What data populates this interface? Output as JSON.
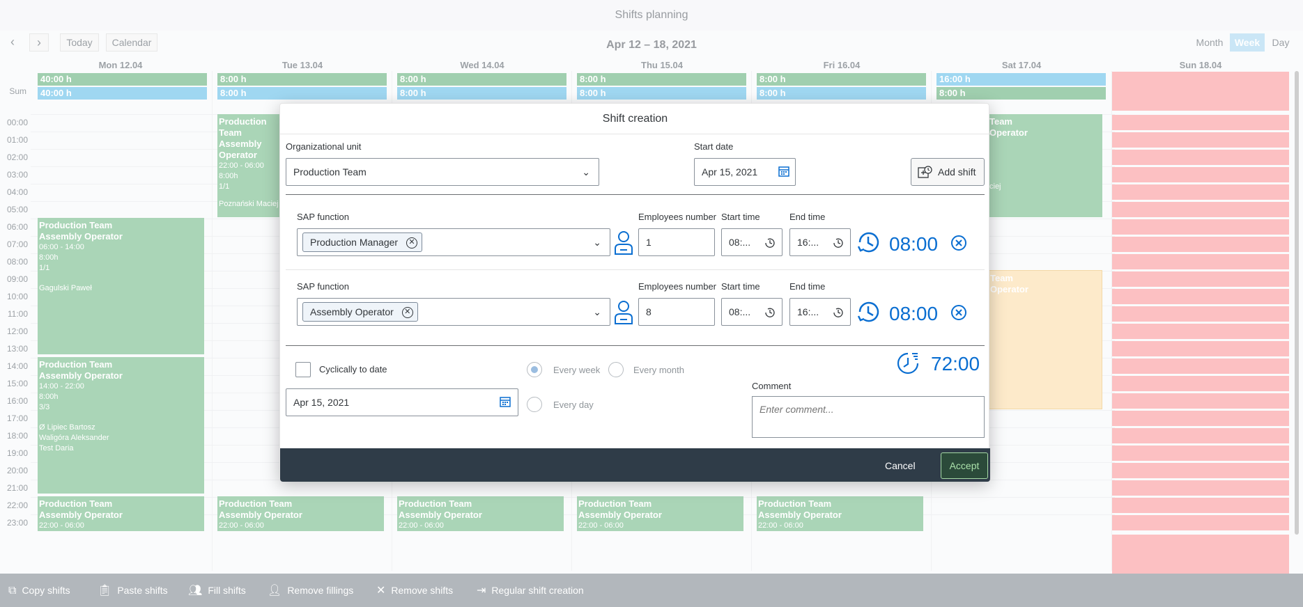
{
  "app": {
    "title": "Shifts planning"
  },
  "nav": {
    "prev_icon": "chevron-left-icon",
    "next_icon": "chevron-right-icon",
    "today": "Today",
    "calendar": "Calendar",
    "date_range": "Apr 12 – 18, 2021"
  },
  "views": {
    "month": "Month",
    "week": "Week",
    "day": "Day",
    "active": "Week"
  },
  "days": [
    "Mon 12.04",
    "Tue 13.04",
    "Wed 14.04",
    "Thu 15.04",
    "Fri 16.04",
    "Sat 17.04",
    "Sun 18.04"
  ],
  "sum": {
    "label": "Sum",
    "rows": [
      [
        "40:00 h",
        "8:00 h",
        "8:00 h",
        "8:00 h",
        "8:00 h",
        "16:00 h"
      ],
      [
        "40:00 h",
        "8:00 h",
        "8:00 h",
        "8:00 h",
        "8:00 h",
        "8:00 h"
      ]
    ]
  },
  "hours": [
    "00:00",
    "01:00",
    "02:00",
    "03:00",
    "04:00",
    "05:00",
    "06:00",
    "07:00",
    "08:00",
    "09:00",
    "10:00",
    "11:00",
    "12:00",
    "13:00",
    "14:00",
    "15:00",
    "16:00",
    "17:00",
    "18:00",
    "19:00",
    "20:00",
    "21:00",
    "22:00",
    "23:00"
  ],
  "shifts": {
    "mon_morning": {
      "team": "Production Team",
      "func": "Assembly Operator",
      "time": "06:00 - 14:00",
      "hours": "8:00h",
      "fill": "1/1",
      "people": "Gagulski Paweł"
    },
    "mon_afternoon": {
      "team": "Production Team",
      "func": "Assembly Operator",
      "time": "14:00 - 22:00",
      "hours": "8:00h",
      "fill": "3/3",
      "people1": "Ø Lipiec Bartosz",
      "people2": "Waligóra Aleksander",
      "people3": "Test Daria"
    },
    "night": {
      "team": "Production Team",
      "func": "Assembly Operator",
      "time": "22:00 - 06:00"
    },
    "tue_night": {
      "team": "Production Team",
      "func": "Assembly Operator",
      "time": "22:00 - 06:00",
      "hours": "8:00h",
      "fill": "1/1",
      "people": "Poznański Maciej"
    },
    "sat_partial_1": "Team",
    "sat_partial_2": "Operator",
    "sat_partial_3": "ciej",
    "sat_orange_1": "Team",
    "sat_orange_2": "Operator"
  },
  "dialog": {
    "title": "Shift creation",
    "org_unit_label": "Organizational unit",
    "org_unit_value": "Production Team",
    "start_date_label": "Start date",
    "start_date_value": "Apr 15, 2021",
    "add_shift": "Add shift",
    "rows": [
      {
        "func_label": "SAP function",
        "func_value": "Production Manager",
        "emp_label": "Employees number",
        "emp_value": "1",
        "start_label": "Start time",
        "start_value": "08:...",
        "end_label": "End time",
        "end_value": "16:...",
        "duration": "08:00"
      },
      {
        "func_label": "SAP function",
        "func_value": "Assembly Operator",
        "emp_label": "Employees number",
        "emp_value": "8",
        "start_label": "Start time",
        "start_value": "08:...",
        "end_label": "End time",
        "end_value": "16:...",
        "duration": "08:00"
      }
    ],
    "cyclic_label": "Cyclically to date",
    "every_week": "Every week",
    "every_month": "Every month",
    "every_day": "Every day",
    "cyclic_date": "Apr 15, 2021",
    "total": "72:00",
    "comment_label": "Comment",
    "comment_placeholder": "Enter comment...",
    "cancel": "Cancel",
    "accept": "Accept"
  },
  "toolbar": {
    "copy": "Copy shifts",
    "paste": "Paste shifts",
    "fill": "Fill shifts",
    "remove_fillings": "Remove fillings",
    "remove_shifts": "Remove shifts",
    "regular": "Regular shift creation"
  },
  "colors": {
    "green": "#9fd0ae",
    "blue": "#92d2ef",
    "red": "#fcb8ba",
    "orange": "#fde7c3",
    "accent": "#0a6ed1"
  }
}
